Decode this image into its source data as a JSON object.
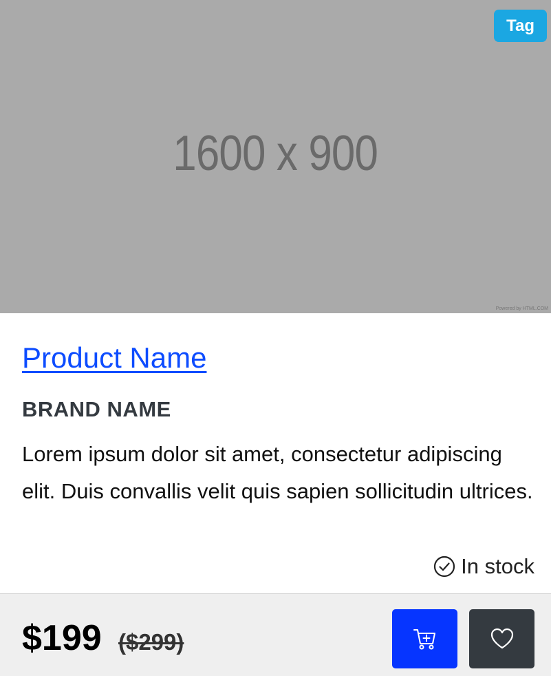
{
  "image": {
    "placeholder_text": "1600 x 900",
    "credit_text": "Powered by HTML.COM"
  },
  "tag": {
    "label": "Tag",
    "color": "#1ba7e2"
  },
  "product": {
    "name": "Product Name",
    "brand": "BRAND NAME",
    "description": "Lorem ipsum dolor sit amet, consectetur adipiscing elit. Duis convallis velit quis sapien sollicitudin ultrices.",
    "stock_status": "In stock",
    "stock_icon": "check-circle-icon"
  },
  "pricing": {
    "price": "$199",
    "old_price": "($299)"
  },
  "actions": {
    "cart_icon": "add-to-cart-icon",
    "wishlist_icon": "heart-icon"
  },
  "colors": {
    "link": "#0d4cff",
    "cart_button": "#0635ff",
    "wishlist_button": "#343a40"
  }
}
